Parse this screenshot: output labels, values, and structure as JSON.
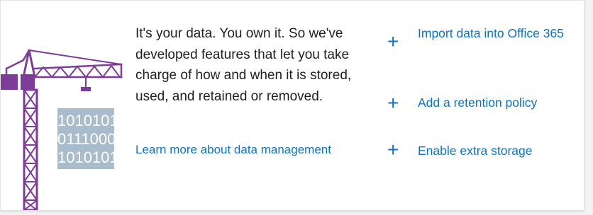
{
  "card": {
    "description": "It's your data. You own it. So we've developed features that let you take charge of how and when it is stored, used, and retained or removed.",
    "learn_more_link": "Learn more about data management"
  },
  "illustration": {
    "icon": "crane-binary-data-icon",
    "binary_lines": [
      "1010101",
      "0111000",
      "1010101"
    ],
    "colors": {
      "crane": "#7d3c98",
      "binary": "#a9bccb",
      "binary_text": "#ffffff"
    }
  },
  "actions": [
    {
      "icon": "plus-icon",
      "label": "Import data into Office 365"
    },
    {
      "icon": "plus-icon",
      "label": "Add a retention policy"
    },
    {
      "icon": "plus-icon",
      "label": "Enable extra storage"
    }
  ],
  "colors": {
    "link": "#0b73c9",
    "text": "#1f1f1f"
  }
}
